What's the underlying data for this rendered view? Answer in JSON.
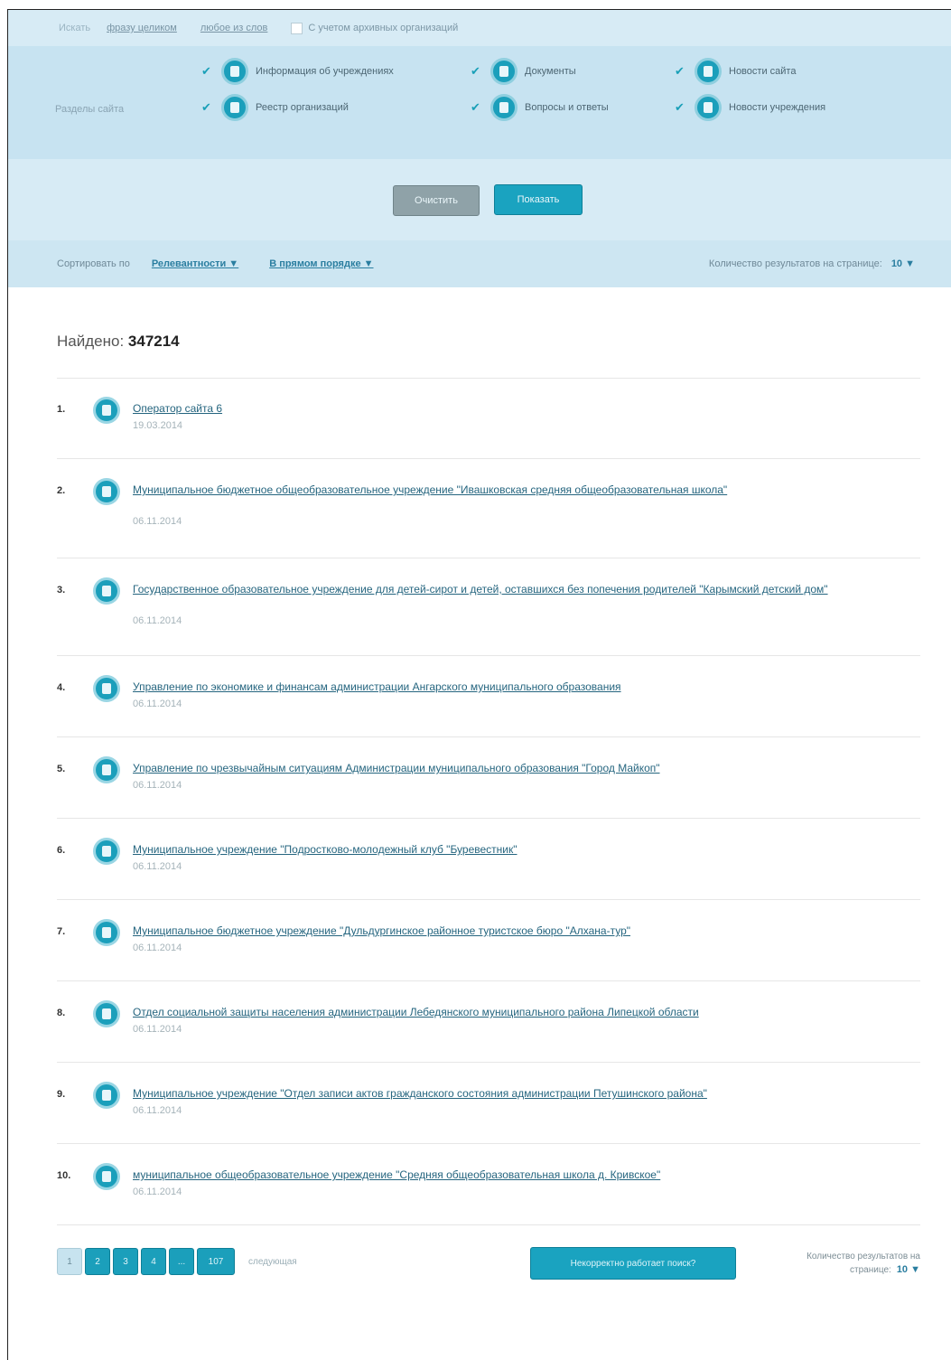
{
  "search": {
    "label": "Искать",
    "options": [
      "фразу целиком",
      "любое из слов"
    ],
    "archived_label": "С учетом архивных организаций"
  },
  "sections": {
    "label": "Разделы сайта",
    "items": [
      {
        "label": "Информация об учреждениях",
        "icon": "building-icon"
      },
      {
        "label": "Документы",
        "icon": "document-icon"
      },
      {
        "label": "Новости сайта",
        "icon": "news-icon"
      },
      {
        "label": "Реестр организаций",
        "icon": "registry-icon"
      },
      {
        "label": "Вопросы и ответы",
        "icon": "question-icon"
      },
      {
        "label": "Новости учреждения",
        "icon": "news-icon"
      }
    ]
  },
  "buttons": {
    "reset": "Очистить",
    "show": "Показать"
  },
  "sort": {
    "label": "Сортировать по",
    "by": "Релевантности ▼",
    "order": "В прямом порядке ▼",
    "count_label": "Количество результатов на странице:",
    "count_value": "10 ▼"
  },
  "found": {
    "label": "Найдено:",
    "value": "347214"
  },
  "results": [
    {
      "num": "1.",
      "title": "Оператор сайта 6",
      "date": "19.03.2014"
    },
    {
      "num": "2.",
      "title": "Муниципальное бюджетное общеобразовательное учреждение \"Ивашковская средняя общеобразовательная школа\"",
      "date": "06.11.2014"
    },
    {
      "num": "3.",
      "title": "Государственное образовательное учреждение для детей-сирот и детей, оставшихся без попечения родителей \"Карымский детский дом\"",
      "date": "06.11.2014"
    },
    {
      "num": "4.",
      "title": "Управление по экономике и финансам администрации Ангарского муниципального образования",
      "date": "06.11.2014"
    },
    {
      "num": "5.",
      "title": "Управление по чрезвычайным ситуациям Администрации муниципального образования \"Город Майкоп\"",
      "date": "06.11.2014"
    },
    {
      "num": "6.",
      "title": "Муниципальное учреждение \"Подростково-молодежный клуб \"Буревестник\"",
      "date": "06.11.2014"
    },
    {
      "num": "7.",
      "title": "Муниципальное бюджетное учреждение \"Дульдургинское районное туристское бюро \"Алхана-тур\"",
      "date": "06.11.2014"
    },
    {
      "num": "8.",
      "title": "Отдел социальной защиты населения администрации Лебедянского муниципального района Липецкой области",
      "date": "06.11.2014"
    },
    {
      "num": "9.",
      "title": "Муниципальное учреждение \"Отдел записи актов гражданского состояния администрации Петушинского района\"",
      "date": "06.11.2014"
    },
    {
      "num": "10.",
      "title": "муниципальное общеобразовательное учреждение \"Средняя общеобразовательная школа д. Кривское\"",
      "date": "06.11.2014"
    }
  ],
  "pager": {
    "pages": [
      "1",
      "2",
      "3",
      "4",
      "...",
      "107"
    ],
    "next": "следующая",
    "feedback": "Некорректно работает поиск?",
    "count_label": "Количество результатов на странице:",
    "count_value": "10 ▼"
  }
}
